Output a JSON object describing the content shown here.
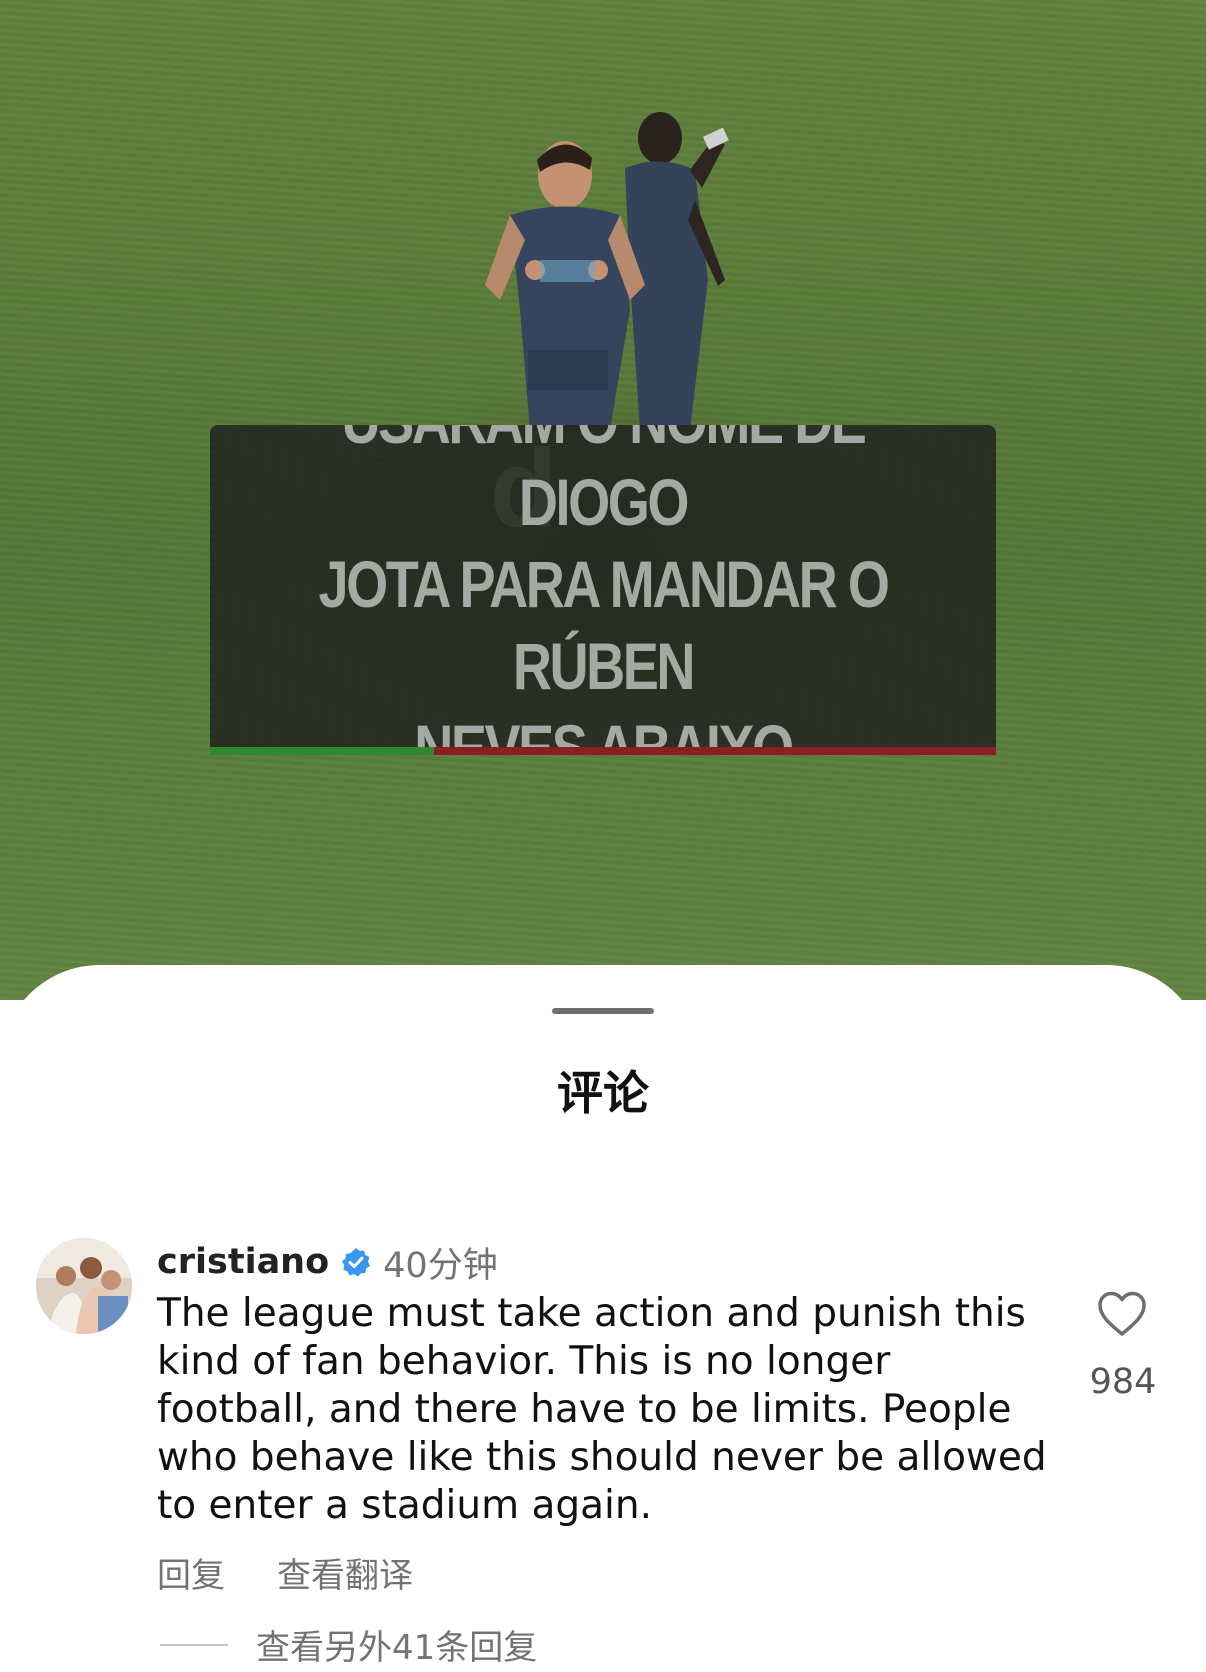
{
  "video": {
    "caption": "USARAM O NOME DE DIOGO\nJOTA PARA MANDAR O RÚBEN\nNEVES ABAIXO"
  },
  "sheet": {
    "title": "评论"
  },
  "comment": {
    "username": "cristiano",
    "verified": true,
    "time": "40分钟",
    "text": "The league must take action and punish this\nkind of fan behavior. This is no longer\nfootball, and there have to be limits. People\nwho behave like this should never be allowed\nto enter a stadium again.",
    "reply_label": "回复",
    "translate_label": "查看翻译",
    "like_count": "984",
    "more_replies": "查看另外41条回复"
  },
  "colors": {
    "verified_badge": "#3897f0",
    "caption_bar_green": "#2e8a2f",
    "caption_bar_red": "#8a1f23"
  }
}
